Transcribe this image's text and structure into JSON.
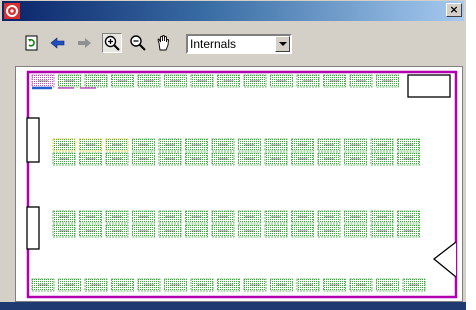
{
  "window": {
    "close_label": "×"
  },
  "toolbar": {
    "buttons": [
      {
        "name": "refresh-icon"
      },
      {
        "name": "back-arrow-icon"
      },
      {
        "name": "forward-arrow-icon"
      },
      {
        "name": "zoom-in-icon",
        "pressed": true
      },
      {
        "name": "zoom-out-icon"
      },
      {
        "name": "pan-hand-icon"
      }
    ],
    "view_select": {
      "value": "Internals"
    }
  },
  "colors": {
    "boundary": "#b000b0",
    "cell_green": "#36a836",
    "cell_yellow": "#d4c000",
    "cell_magenta": "#c04fc0",
    "cell_blue": "#2060d0"
  },
  "canvas": {
    "rows": [
      {
        "count": 14,
        "colored": [
          [
            "blue",
            "magenta",
            "magenta"
          ]
        ]
      },
      {
        "count": 13,
        "colored": [
          [
            "yellow",
            "yellow",
            "yellow"
          ]
        ]
      },
      {
        "count": 13
      },
      {
        "count": 14
      }
    ]
  }
}
